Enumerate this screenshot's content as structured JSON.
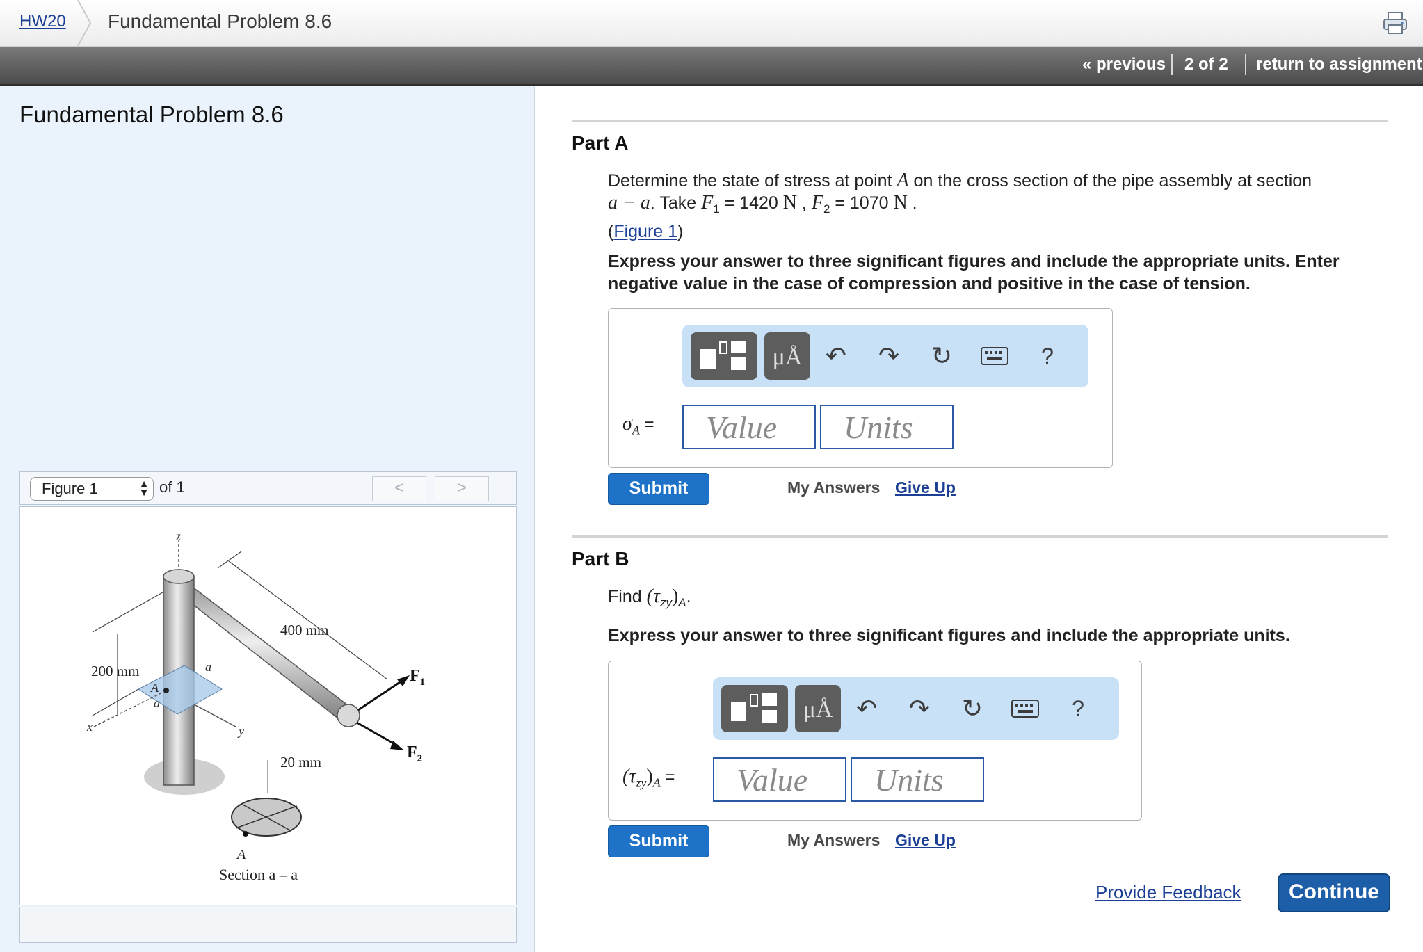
{
  "header": {
    "breadcrumb_link": "HW20",
    "title": "Fundamental Problem 8.6"
  },
  "nav": {
    "previous": "« previous",
    "position": "2 of 2",
    "return": "return to assignment"
  },
  "left": {
    "problem_title": "Fundamental Problem 8.6",
    "figure_select": "Figure 1",
    "figure_of": "of 1",
    "prev_btn": "<",
    "next_btn": ">",
    "figure_labels": {
      "z": "z",
      "len400": "400 mm",
      "len200": "200 mm",
      "a_top": "a",
      "a_bottom": "a",
      "A_point": "A",
      "x": "x",
      "y": "y",
      "F1": "F",
      "F1_sub": "1",
      "F2": "F",
      "F2_sub": "2",
      "mm20": "20 mm",
      "A_section": "A",
      "section": "Section a – a"
    }
  },
  "partA": {
    "title": "Part A",
    "q_line1_pre": "Determine the state of stress at point ",
    "q_line1_A": "A",
    "q_line1_post": " on the cross section of the pipe assembly at section",
    "q_line2_sec": "a − a",
    "q_line2_take": ". Take ",
    "q_F1": "F",
    "q_F1_sub": "1",
    "q_F1_val": " = 1420 ",
    "q_N1": "N",
    "q_comma": " , ",
    "q_F2": "F",
    "q_F2_sub": "2",
    "q_F2_val": " = 1070 ",
    "q_N2": "N",
    "q_dot": " .",
    "figure_open": "(",
    "figure_link": "Figure 1",
    "figure_close": ")",
    "instruction": "Express your answer to three significant figures and include the appropriate units. Enter negative value in the case of compression and positive in the case of tension.",
    "label": "σA =",
    "label_sigma": "σ",
    "label_sub": "A",
    "label_eq": " =",
    "value_placeholder": "Value",
    "units_placeholder": "Units",
    "submit": "Submit",
    "my_answers": "My Answers",
    "give_up": "Give Up"
  },
  "partB": {
    "title": "Part B",
    "q_find": "Find ",
    "q_tau": "(τ",
    "q_tau_sub": "zy",
    "q_tau_close": ")",
    "q_A": "A",
    "q_dot": ".",
    "instruction": "Express your answer to three significant figures and include the appropriate units.",
    "label_tau": "(τ",
    "label_sub": "zy",
    "label_close": ")",
    "label_A": "A",
    "label_eq": " =",
    "value_placeholder": "Value",
    "units_placeholder": "Units",
    "submit": "Submit",
    "my_answers": "My Answers",
    "give_up": "Give Up"
  },
  "toolbar": {
    "mu_label": "μÅ",
    "help": "?"
  },
  "footer": {
    "provide_feedback": "Provide Feedback",
    "continue": "Continue"
  },
  "colors": {
    "accent_blue": "#1e73c8",
    "toolbar_bg": "#c8e1f7",
    "left_panel_bg": "#eaf3fc"
  }
}
